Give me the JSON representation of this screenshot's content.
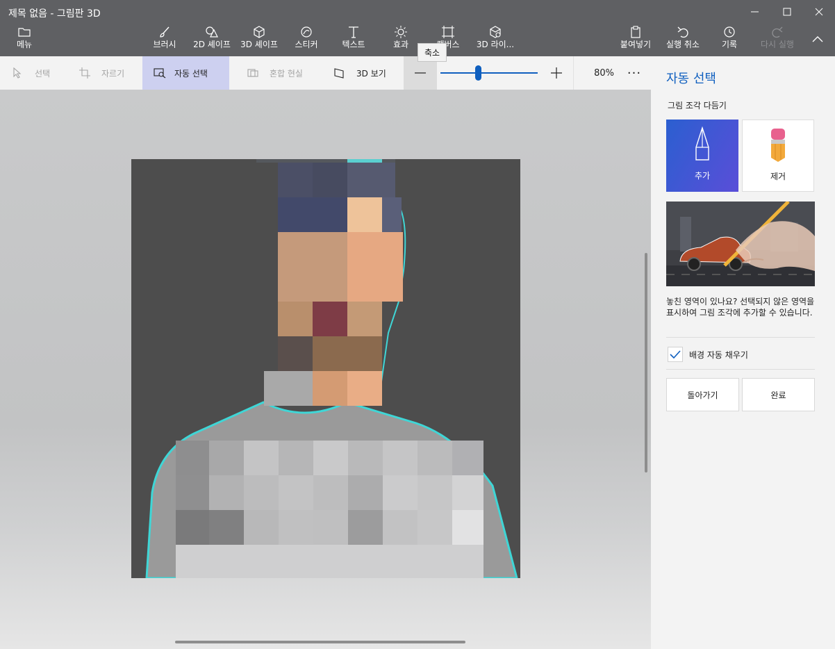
{
  "window": {
    "title": "제목 없음 - 그림판 3D"
  },
  "ribbon": {
    "menu": "메뉴",
    "brush": "브러시",
    "shapes2d": "2D 셰이프",
    "shapes3d": "3D 셰이프",
    "sticker": "스티커",
    "text": "텍스트",
    "effects": "효과",
    "canvas": "캔버스",
    "library3d": "3D 라이...",
    "paste": "붙여넣기",
    "undo": "실행 취소",
    "history": "기록",
    "redo": "다시 실행"
  },
  "toolbar": {
    "select": "선택",
    "crop": "자르기",
    "magic_select": "자동 선택",
    "mixed_reality": "혼합 현실",
    "view3d": "3D 보기",
    "zoom_value": "80%",
    "zoom_percent": 80,
    "more": "···"
  },
  "tooltip": {
    "text": "축소"
  },
  "panel": {
    "title": "자동 선택",
    "subtitle": "그림 조각 다듬기",
    "add_label": "추가",
    "remove_label": "제거",
    "help_text": "놓친 영역이 있나요? 선택되지 않은 영역을 표시하여 그림 조각에 추가할 수 있습니다.",
    "autofill_label": "배경 자동 채우기",
    "autofill_checked": true,
    "back_label": "돌아가기",
    "done_label": "완료"
  },
  "colors": {
    "chrome": "#5f6063",
    "accent": "#0f5fbf",
    "active_tool": "#cdd0f0",
    "selection_outline": "#3fd6d6"
  }
}
